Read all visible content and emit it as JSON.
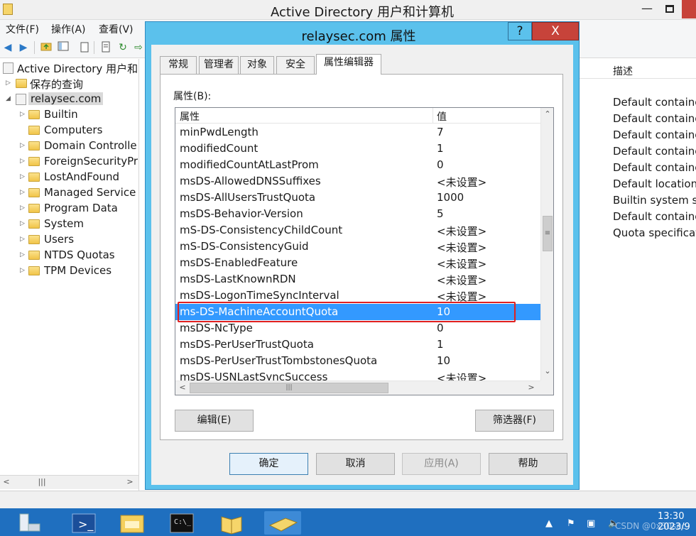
{
  "window": {
    "title": "Active Directory 用户和计算机",
    "min_glyph": "—"
  },
  "menu": [
    "文件(F)",
    "操作(A)",
    "查看(V)"
  ],
  "tree": {
    "root_label": "Active Directory 用户和",
    "saved_queries": "保存的查询",
    "domain": "relaysec.com",
    "children": [
      "Builtin",
      "Computers",
      "Domain Controller",
      "ForeignSecurityPr",
      "LostAndFound",
      "Managed Service",
      "Program Data",
      "System",
      "Users",
      "NTDS Quotas",
      "TPM Devices"
    ]
  },
  "right_pane": {
    "column_header": "描述",
    "descriptions": [
      "Default containe",
      "Default containe",
      "Default containe",
      "Default containe",
      "Default containe",
      "Default location",
      "Builtin system se",
      "Default containe",
      "Quota specificat"
    ]
  },
  "dialog": {
    "title": "relaysec.com 属性",
    "help_glyph": "?",
    "close_glyph": "X",
    "tabs": [
      "常规",
      "管理者",
      "对象",
      "安全",
      "属性编辑器"
    ],
    "active_tab": "属性编辑器",
    "attributes_label": "属性(B):",
    "columns": {
      "name": "属性",
      "value": "值"
    },
    "rows": [
      {
        "name": "minPwdLength",
        "value": "7"
      },
      {
        "name": "modifiedCount",
        "value": "1"
      },
      {
        "name": "modifiedCountAtLastProm",
        "value": "0"
      },
      {
        "name": "msDS-AllowedDNSSuffixes",
        "value": "<未设置>"
      },
      {
        "name": "msDS-AllUsersTrustQuota",
        "value": "1000"
      },
      {
        "name": "msDS-Behavior-Version",
        "value": "5"
      },
      {
        "name": "mS-DS-ConsistencyChildCount",
        "value": "<未设置>"
      },
      {
        "name": "mS-DS-ConsistencyGuid",
        "value": "<未设置>"
      },
      {
        "name": "msDS-EnabledFeature",
        "value": "<未设置>"
      },
      {
        "name": "msDS-LastKnownRDN",
        "value": "<未设置>"
      },
      {
        "name": "msDS-LogonTimeSyncInterval",
        "value": "<未设置>"
      },
      {
        "name": "ms-DS-MachineAccountQuota",
        "value": "10"
      },
      {
        "name": "msDS-NcType",
        "value": "0"
      },
      {
        "name": "msDS-PerUserTrustQuota",
        "value": "1"
      },
      {
        "name": "msDS-PerUserTrustTombstonesQuota",
        "value": "10"
      },
      {
        "name": "msDS-USNLastSyncSuccess",
        "value": "<未设置>"
      }
    ],
    "selected_row": "ms-DS-MachineAccountQuota",
    "edit_button": "编辑(E)",
    "filter_button": "筛选器(F)",
    "ok_button": "确定",
    "cancel_button": "取消",
    "apply_button": "应用(A)",
    "help_button": "帮助"
  },
  "taskbar": {
    "time": "13:30",
    "date": "2023/9",
    "watermark": "CSDN @0x30sec"
  },
  "colors": {
    "dialog_frame": "#5bc1ec",
    "selection": "#3399ff",
    "highlight_box": "#e02020",
    "taskbar": "#1f6fbf",
    "close_button": "#c7433a"
  }
}
